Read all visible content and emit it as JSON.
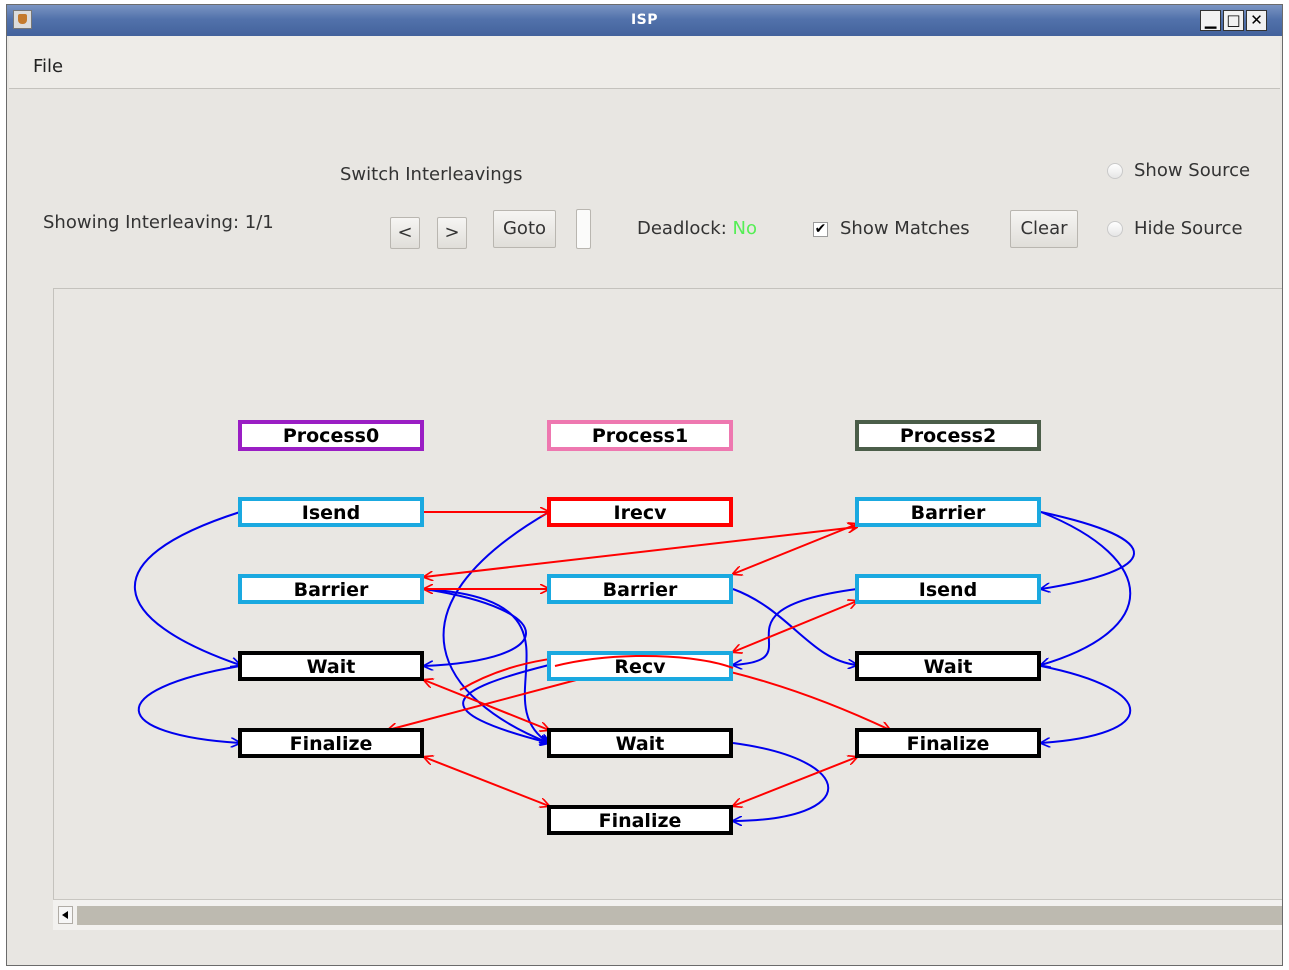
{
  "window": {
    "title": "ISP"
  },
  "menu": {
    "file": "File"
  },
  "controls": {
    "switch_label": "Switch Interleavings",
    "showing_label": "Showing Interleaving:",
    "showing_value": "1/1",
    "prev_button": "<",
    "next_button": ">",
    "goto_button": "Goto",
    "deadlock_label": "Deadlock:",
    "deadlock_value": "No",
    "show_matches_label": "Show Matches",
    "show_matches_checked": true,
    "clear_button": "Clear",
    "show_source_label": "Show Source",
    "hide_source_label": "Hide Source"
  },
  "colors": {
    "process0": "#9a1ec4",
    "process1": "#ee78b0",
    "process2": "#4b5e49",
    "op_border": "#1aa9e0",
    "irecv_border": "#ff0000",
    "final_border": "#000000",
    "match_edge": "#ff0000",
    "order_edge": "#0000ee",
    "deadlock_no": "#55ee55"
  },
  "graph": {
    "nodes": [
      {
        "id": "p0",
        "label": "Process0",
        "style": "process0"
      },
      {
        "id": "p1",
        "label": "Process1",
        "style": "process1"
      },
      {
        "id": "p2",
        "label": "Process2",
        "style": "process2"
      },
      {
        "id": "p0_isend",
        "label": "Isend",
        "style": "op"
      },
      {
        "id": "p1_irecv",
        "label": "Irecv",
        "style": "irecv"
      },
      {
        "id": "p2_barrier",
        "label": "Barrier",
        "style": "op"
      },
      {
        "id": "p0_barrier",
        "label": "Barrier",
        "style": "op"
      },
      {
        "id": "p1_barrier",
        "label": "Barrier",
        "style": "op"
      },
      {
        "id": "p2_isend",
        "label": "Isend",
        "style": "op"
      },
      {
        "id": "p0_wait",
        "label": "Wait",
        "style": "final"
      },
      {
        "id": "p1_recv",
        "label": "Recv",
        "style": "op"
      },
      {
        "id": "p2_wait",
        "label": "Wait",
        "style": "final"
      },
      {
        "id": "p0_finalize",
        "label": "Finalize",
        "style": "final"
      },
      {
        "id": "p1_wait",
        "label": "Wait",
        "style": "final"
      },
      {
        "id": "p2_finalize",
        "label": "Finalize",
        "style": "final"
      },
      {
        "id": "p1_finalize",
        "label": "Finalize",
        "style": "final"
      }
    ]
  }
}
